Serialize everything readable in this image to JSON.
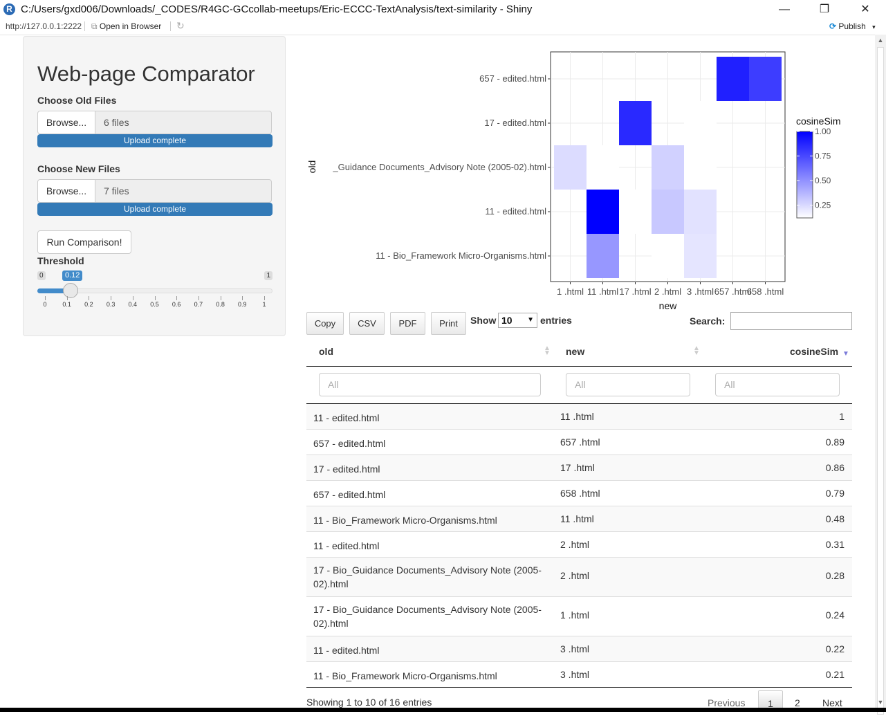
{
  "window": {
    "title": "C:/Users/gxd006/Downloads/_CODES/R4GC-GCcollab-meetups/Eric-ECCC-TextAnalysis/text-similarity - Shiny",
    "minimize": "—",
    "maximize": "❐",
    "close": "✕"
  },
  "addressbar": {
    "url": "http://127.0.0.1:2222",
    "open_in_browser": "Open in Browser",
    "publish": "Publish"
  },
  "sidebar": {
    "title": "Web-page Comparator",
    "old_files_label": "Choose Old Files",
    "old_browse": "Browse...",
    "old_count": "6 files",
    "old_progress": "Upload complete",
    "new_files_label": "Choose New Files",
    "new_browse": "Browse...",
    "new_count": "7 files",
    "new_progress": "Upload complete",
    "run_button": "Run Comparison!",
    "threshold_label": "Threshold",
    "slider": {
      "min": "0",
      "max": "1",
      "value": 0.12,
      "value_label": "0.12",
      "ticks": [
        "0",
        "0.1",
        "0.2",
        "0.3",
        "0.4",
        "0.5",
        "0.6",
        "0.7",
        "0.8",
        "0.9",
        "1"
      ]
    }
  },
  "chart_data": {
    "type": "heatmap",
    "xlabel": "new",
    "ylabel": "old",
    "x_categories": [
      "1 .html",
      "11 .html",
      "17 .html",
      "2 .html",
      "3 .html",
      "657 .html",
      "658 .html"
    ],
    "y_categories": [
      "11 - Bio_Framework Micro-Organisms.html",
      "11 - edited.html",
      "17 - Bio_Guidance Documents_Advisory Note (2005-02).html",
      "17 - edited.html",
      "657 - edited.html"
    ],
    "y_tick_labels": [
      "11 - Bio_Framework Micro-Organisms.html",
      "11 - edited.html",
      "_Guidance Documents_Advisory Note (2005-02).html",
      "17 - edited.html",
      "657 - edited.html"
    ],
    "cells": [
      {
        "x": "11 .html",
        "y": "11 - Bio_Framework Micro-Organisms.html",
        "value": 0.48
      },
      {
        "x": "2 .html",
        "y": "11 - Bio_Framework Micro-Organisms.html",
        "value": 0.05
      },
      {
        "x": "3 .html",
        "y": "11 - Bio_Framework Micro-Organisms.html",
        "value": 0.21
      },
      {
        "x": "11 .html",
        "y": "11 - edited.html",
        "value": 1
      },
      {
        "x": "17 .html",
        "y": "11 - edited.html",
        "value": 0.04
      },
      {
        "x": "2 .html",
        "y": "11 - edited.html",
        "value": 0.31
      },
      {
        "x": "3 .html",
        "y": "11 - edited.html",
        "value": 0.22
      },
      {
        "x": "1 .html",
        "y": "17 - Bio_Guidance Documents_Advisory Note (2005-02).html",
        "value": 0.24
      },
      {
        "x": "11 .html",
        "y": "17 - Bio_Guidance Documents_Advisory Note (2005-02).html",
        "value": 0.1
      },
      {
        "x": "2 .html",
        "y": "17 - Bio_Guidance Documents_Advisory Note (2005-02).html",
        "value": 0.28
      },
      {
        "x": "3 .html",
        "y": "17 - Bio_Guidance Documents_Advisory Note (2005-02).html",
        "value": 0.06
      },
      {
        "x": "17 .html",
        "y": "17 - edited.html",
        "value": 0.86
      },
      {
        "x": "3 .html",
        "y": "17 - edited.html",
        "value": 0.12
      },
      {
        "x": "657 .html",
        "y": "657 - edited.html",
        "value": 0.89
      },
      {
        "x": "658 .html",
        "y": "657 - edited.html",
        "value": 0.79
      }
    ],
    "legend": {
      "title": "cosineSim",
      "ticks": [
        "1.00",
        "0.75",
        "0.50",
        "0.25"
      ],
      "tick_values": [
        1.0,
        0.75,
        0.5,
        0.25
      ],
      "low_color": "#ffffff",
      "high_color": "#0000ff",
      "range": [
        0.12,
        1.0
      ]
    },
    "grid": true
  },
  "table": {
    "buttons": [
      "Copy",
      "CSV",
      "PDF",
      "Print"
    ],
    "show_label": "Show",
    "length_value": "10",
    "entries_label": "entries",
    "search_label": "Search:",
    "columns": [
      "old",
      "new",
      "cosineSim"
    ],
    "filter_placeholder": "All",
    "rows": [
      {
        "old": "11 - edited.html",
        "new": "11 .html",
        "cosineSim": "1"
      },
      {
        "old": "657 - edited.html",
        "new": "657 .html",
        "cosineSim": "0.89"
      },
      {
        "old": "17 - edited.html",
        "new": "17 .html",
        "cosineSim": "0.86"
      },
      {
        "old": "657 - edited.html",
        "new": "658 .html",
        "cosineSim": "0.79"
      },
      {
        "old": "11 - Bio_Framework Micro-Organisms.html",
        "new": "11 .html",
        "cosineSim": "0.48"
      },
      {
        "old": "11 - edited.html",
        "new": "2 .html",
        "cosineSim": "0.31"
      },
      {
        "old": "17 - Bio_Guidance Documents_Advisory Note (2005-02).html",
        "new": "2 .html",
        "cosineSim": "0.28"
      },
      {
        "old": "17 - Bio_Guidance Documents_Advisory Note (2005-02).html",
        "new": "1 .html",
        "cosineSim": "0.24"
      },
      {
        "old": "11 - edited.html",
        "new": "3 .html",
        "cosineSim": "0.22"
      },
      {
        "old": "11 - Bio_Framework Micro-Organisms.html",
        "new": "3 .html",
        "cosineSim": "0.21"
      }
    ],
    "info": "Showing 1 to 10 of 16 entries",
    "pagination": {
      "previous": "Previous",
      "pages": [
        "1",
        "2"
      ],
      "next": "Next"
    }
  }
}
